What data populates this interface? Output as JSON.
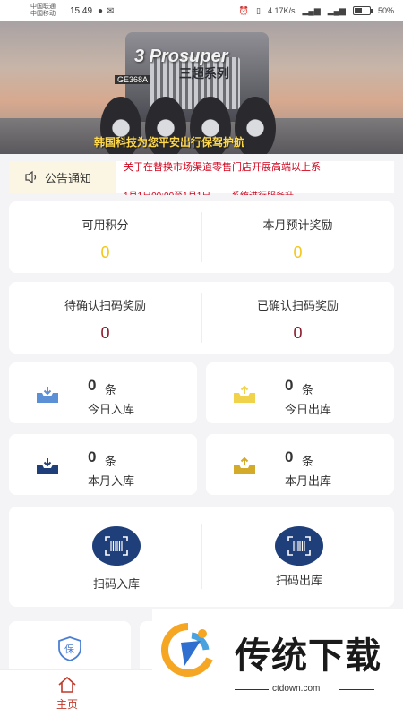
{
  "status_bar": {
    "carrier1": "中国联通",
    "carrier2": "中国移动",
    "time": "15:49",
    "speed": "4.17K/s",
    "battery": "50%",
    "battery_level": 0.5
  },
  "banner": {
    "logo_text": "3 Prosuper",
    "sub_text": "三超系列",
    "plate_text": "GE368A",
    "caption": "韩国科技为您平安出行保驾护航"
  },
  "notice": {
    "label": "公告通知",
    "text": "关于在替换市场渠道零售门店开展高端以上系",
    "text2": "1月1日00:00至1月1日… …系统进行服务升"
  },
  "points": {
    "available_label": "可用积分",
    "available_value": "0",
    "monthly_label": "本月预计奖励",
    "monthly_value": "0"
  },
  "scan_rewards": {
    "pending_label": "待确认扫码奖励",
    "pending_value": "0",
    "confirmed_label": "已确认扫码奖励",
    "confirmed_value": "0"
  },
  "counts": [
    {
      "num": "0",
      "unit": "条",
      "caption": "今日入库",
      "icon": "inbox-in-icon"
    },
    {
      "num": "0",
      "unit": "条",
      "caption": "今日出库",
      "icon": "inbox-out-icon"
    },
    {
      "num": "0",
      "unit": "条",
      "caption": "本月入库",
      "icon": "inbox-in-icon"
    },
    {
      "num": "0",
      "unit": "条",
      "caption": "本月出库",
      "icon": "inbox-out-icon"
    }
  ],
  "scan": {
    "in_label": "扫码入库",
    "out_label": "扫码出库"
  },
  "tabbar": {
    "home_label": "主页"
  },
  "watermark": {
    "title": "传统下载",
    "url": "ctdown.com"
  },
  "colors": {
    "accent_red": "#c0392b",
    "gold": "#f5c518",
    "navy": "#1f3f7a",
    "notice_red": "#d0021b"
  }
}
